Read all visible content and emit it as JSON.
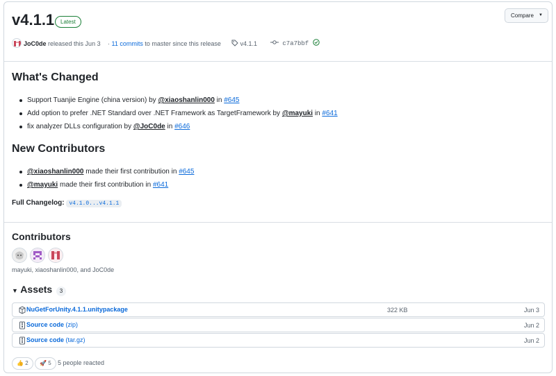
{
  "release": {
    "tag_title": "v4.1.1",
    "latest_badge": "Latest",
    "compare_label": "Compare",
    "author": "JoC0de",
    "released_text": "released this Jun 3",
    "commits_link": "11 commits",
    "commits_suffix": "to master since this release",
    "tag": "v4.1.1",
    "commit_sha": "c7a7bbf"
  },
  "whats_changed": {
    "heading": "What's Changed",
    "items": [
      {
        "text": "Support Tuanjie Engine (china version) by ",
        "mention": "@xiaoshanlin000",
        "in": " in ",
        "issue": "#645"
      },
      {
        "text": "Add option to prefer .NET Standard over .NET Framework as TargetFramework by ",
        "mention": "@mayuki",
        "in": " in ",
        "issue": "#641"
      },
      {
        "text": "fix analyzer DLLs configuration by ",
        "mention": "@JoC0de",
        "in": " in ",
        "issue": "#646"
      }
    ]
  },
  "new_contributors": {
    "heading": "New Contributors",
    "items": [
      {
        "mention": "@xiaoshanlin000",
        "text": " made their first contribution in ",
        "issue": "#645"
      },
      {
        "mention": "@mayuki",
        "text": " made their first contribution in ",
        "issue": "#641"
      }
    ]
  },
  "changelog": {
    "label": "Full Changelog",
    "colon": ":",
    "range": "v4.1.0...v4.1.1"
  },
  "contributors": {
    "heading": "Contributors",
    "names": "mayuki, xiaoshanlin000, and JoC0de"
  },
  "assets": {
    "heading": "Assets",
    "count": "3",
    "files": [
      {
        "name": "NuGetForUnity.4.1.1.unitypackage",
        "sub": "",
        "size": "322 KB",
        "date": "Jun 3"
      },
      {
        "name": "Source code",
        "sub": "(zip)",
        "size": "",
        "date": "Jun 2"
      },
      {
        "name": "Source code",
        "sub": "(tar.gz)",
        "size": "",
        "date": "Jun 2"
      }
    ]
  },
  "reactions": {
    "thumbs_count": "2",
    "rocket_count": "5",
    "summary": "5 people reacted"
  },
  "colors": {
    "link": "#0969da",
    "latest_green": "#1a7f37",
    "border": "#d0d7de"
  }
}
